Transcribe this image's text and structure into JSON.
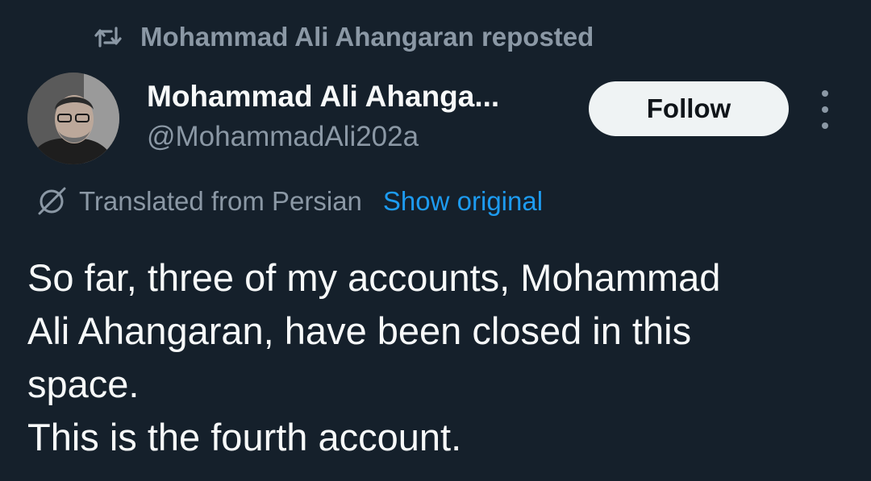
{
  "repost": {
    "icon": "repost-icon",
    "text": "Mohammad Ali Ahangaran reposted"
  },
  "author": {
    "display_name": "Mohammad Ali Ahanga...",
    "handle": "@MohammadAli202a"
  },
  "follow_button": {
    "label": "Follow"
  },
  "translation": {
    "icon": "globe-slash-icon",
    "text": "Translated from Persian",
    "link": "Show original"
  },
  "tweet": {
    "lines": [
      "So far, three of my accounts, Mohammad",
      "Ali Ahangaran, have been closed in this",
      "space.",
      "This is the fourth account."
    ]
  },
  "colors": {
    "background": "#15202b",
    "primary_text": "#f7f9f9",
    "secondary_text": "#8b98a5",
    "link": "#1d9bf0",
    "button_bg": "#eff3f4"
  }
}
